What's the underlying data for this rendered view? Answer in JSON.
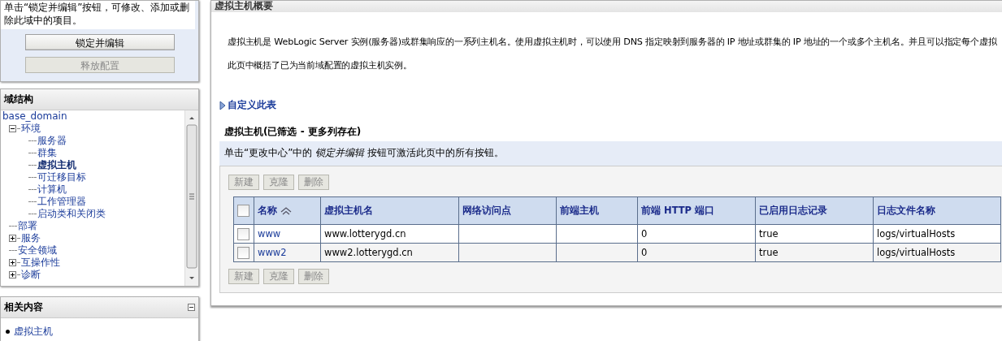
{
  "change_center": {
    "message": "单击“锁定并编辑”按钮，可修改、添加或删除此域中的项目。",
    "buttons": [
      {
        "label": "锁定并编辑",
        "disabled": false
      },
      {
        "label": "释放配置",
        "disabled": true
      }
    ]
  },
  "domain_structure": {
    "title": "域结构",
    "tree": [
      {
        "label": "base_domain",
        "selected": false,
        "children": [
          {
            "label": "环境",
            "selected": false,
            "expanded": true,
            "children": [
              {
                "label": "服务器",
                "selected": false
              },
              {
                "label": "群集",
                "selected": false
              },
              {
                "label": "虚拟主机",
                "selected": true
              },
              {
                "label": "可迁移目标",
                "selected": false
              },
              {
                "label": "计算机",
                "selected": false
              },
              {
                "label": "工作管理器",
                "selected": false
              },
              {
                "label": "启动类和关闭类",
                "selected": false
              }
            ]
          },
          {
            "label": "部署",
            "selected": false
          },
          {
            "label": "服务",
            "selected": false,
            "expanded": false
          },
          {
            "label": "安全领域",
            "selected": false
          },
          {
            "label": "互操作性",
            "selected": false,
            "expanded": false
          },
          {
            "label": "诊断",
            "selected": false,
            "expanded": false
          }
        ]
      }
    ]
  },
  "related_content": {
    "title": "相关内容",
    "expanded": true,
    "items": [
      "虚拟主机"
    ]
  },
  "main": {
    "title": "虚拟主机概要",
    "paragraphs": [
      "虚拟主机是 WebLogic Server 实例(服务器)或群集响应的一系列主机名。使用虚拟主机时，可以使用 DNS 指定映射到服务器的 IP 地址或群集的 IP 地址的一个或多个主机名。并且可以指定每个虚拟",
      "此页中概括了已为当前域配置的虚拟主机实例。"
    ],
    "customize_link": "自定义此表",
    "table_title": "虚拟主机(已筛选 - 更多列存在)",
    "info": "单击“更改中心”中的 *锁定并编辑* 按钮可激活此页中的所有按钮。",
    "toolbar_top": [
      {
        "label": "新建",
        "disabled": true
      },
      {
        "label": "克隆",
        "disabled": true
      },
      {
        "label": "删除",
        "disabled": true
      }
    ],
    "table": {
      "select_all_checked": false,
      "columns": [
        {
          "label": "名称",
          "sortable": true
        },
        {
          "label": "虚拟主机名",
          "sortable": false
        },
        {
          "label": "网络访问点",
          "sortable": false
        },
        {
          "label": "前端主机",
          "sortable": false
        },
        {
          "label": "前端 HTTP 端口",
          "sortable": false
        },
        {
          "label": "已启用日志记录",
          "sortable": false
        },
        {
          "label": "日志文件名称",
          "sortable": false
        }
      ],
      "rows": [
        {
          "checked": false,
          "cells": [
            "www",
            "www.lotterygd.cn",
            "",
            "",
            "0",
            "true",
            "logs/virtualHosts"
          ]
        },
        {
          "checked": false,
          "cells": [
            "www2",
            "www2.lotterygd.cn",
            "",
            "",
            "0",
            "true",
            "logs/virtualHosts"
          ]
        }
      ]
    },
    "toolbar_bottom": [
      {
        "label": "新建",
        "disabled": true
      },
      {
        "label": "克隆",
        "disabled": true
      },
      {
        "label": "删除",
        "disabled": true
      }
    ]
  }
}
